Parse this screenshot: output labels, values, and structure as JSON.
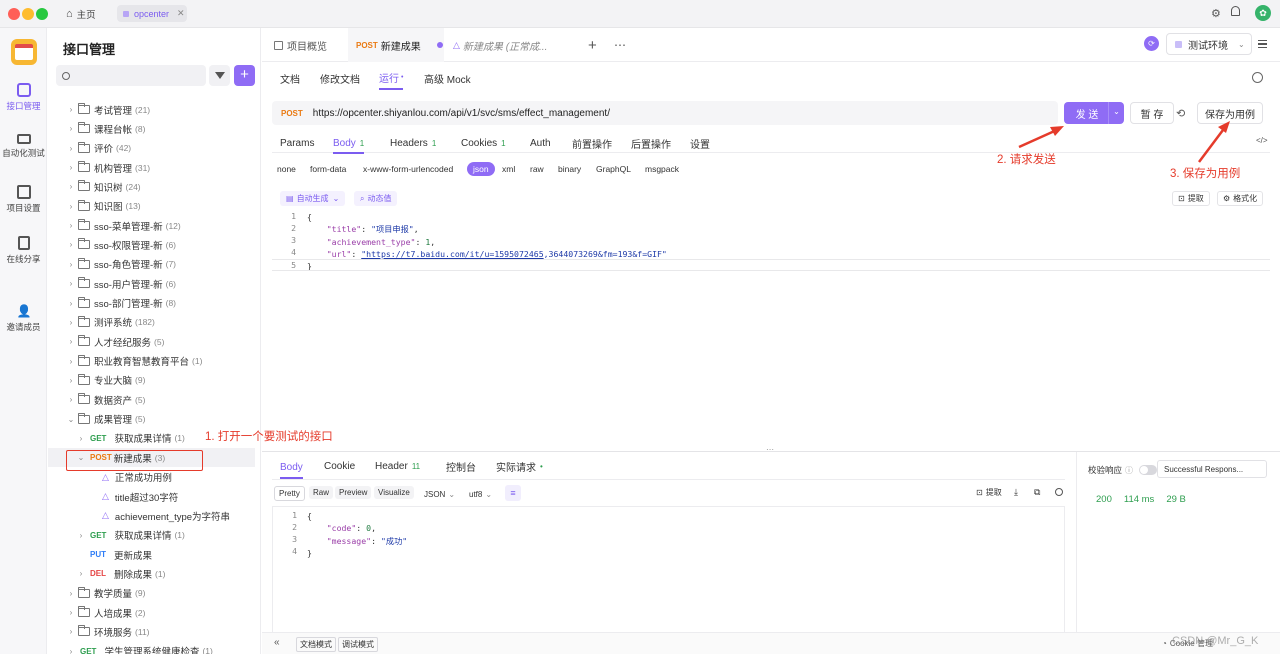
{
  "titlebar": {
    "home": "主页",
    "tab": "opcenter"
  },
  "sidebar": {
    "items": [
      "接口管理",
      "自动化测试",
      "项目设置",
      "在线分享",
      "邀请成员"
    ]
  },
  "tree": {
    "title": "接口管理",
    "folders": [
      {
        "name": "考试管理",
        "count": "(21)"
      },
      {
        "name": "课程台帐",
        "count": "(8)"
      },
      {
        "name": "评价",
        "count": "(42)"
      },
      {
        "name": "机构管理",
        "count": "(31)"
      },
      {
        "name": "知识树",
        "count": "(24)"
      },
      {
        "name": "知识图",
        "count": "(13)"
      },
      {
        "name": "sso-菜单管理-新",
        "count": "(12)"
      },
      {
        "name": "sso-权限管理-新",
        "count": "(6)"
      },
      {
        "name": "sso-角色管理-新",
        "count": "(7)"
      },
      {
        "name": "sso-用户管理-新",
        "count": "(6)"
      },
      {
        "name": "sso-部门管理-新",
        "count": "(8)"
      },
      {
        "name": "测评系统",
        "count": "(182)"
      },
      {
        "name": "人才经纪服务",
        "count": "(5)"
      },
      {
        "name": "职业教育智慧教育平台",
        "count": "(1)"
      },
      {
        "name": "专业大脑",
        "count": "(9)"
      },
      {
        "name": "数据资产",
        "count": "(5)"
      },
      {
        "name": "成果管理",
        "count": "(5)"
      }
    ],
    "achievement_items": [
      {
        "method": "GET",
        "name": "获取成果详情",
        "count": "(1)"
      },
      {
        "method": "POST",
        "name": "新建成果",
        "count": "(3)"
      }
    ],
    "cases": [
      "正常成功用例",
      "title超过30字符",
      "achievement_type为字符串"
    ],
    "after_items": [
      {
        "method": "GET",
        "name": "获取成果详情",
        "count": "(1)"
      },
      {
        "method": "PUT",
        "name": "更新成果",
        "count": ""
      },
      {
        "method": "DEL",
        "name": "删除成果",
        "count": "(1)"
      }
    ],
    "folders_after": [
      {
        "name": "教学质量",
        "count": "(9)"
      },
      {
        "name": "人培成果",
        "count": "(2)"
      },
      {
        "name": "环境服务",
        "count": "(11)"
      }
    ],
    "last_item": {
      "method": "GET",
      "name": "学生管理系统健康检查",
      "count": "(1)"
    }
  },
  "tabs": {
    "overview": "项目概览",
    "active_method": "POST",
    "active": "新建成果",
    "draft": "新建成果 (正常成..."
  },
  "env": "测试环境",
  "subtabs": [
    "文档",
    "修改文档",
    "运行",
    "高级 Mock"
  ],
  "request": {
    "method": "POST",
    "url": "https://opcenter.shiyanlou.com/api/v1/svc/sms/effect_management/",
    "send": "发 送",
    "save_temp": "暂 存",
    "save_case": "保存为用例"
  },
  "param_tabs": [
    {
      "label": "Params",
      "badge": ""
    },
    {
      "label": "Body",
      "badge": "1"
    },
    {
      "label": "Headers",
      "badge": "1"
    },
    {
      "label": "Cookies",
      "badge": "1"
    },
    {
      "label": "Auth",
      "badge": ""
    },
    {
      "label": "前置操作",
      "badge": ""
    },
    {
      "label": "后置操作",
      "badge": ""
    },
    {
      "label": "设置",
      "badge": ""
    }
  ],
  "body_types": [
    "none",
    "form-data",
    "x-www-form-urlencoded",
    "json",
    "xml",
    "raw",
    "binary",
    "GraphQL",
    "msgpack"
  ],
  "tools": {
    "auto": "自动生成",
    "dynamic": "动态值",
    "extract": "提取",
    "format": "格式化"
  },
  "body_code": {
    "title_key": "\"title\"",
    "title_val": "\"项目申报\"",
    "type_key": "\"achievement_type\"",
    "type_val": "1",
    "url_key": "\"url\"",
    "url_val": "\"https://t7.baidu.com/it/u=1595072465",
    "url_tail": ",3644073269&fm=193&f=GIF\""
  },
  "annotations": {
    "a1": "1. 打开一个要测试的接口",
    "a2": "2. 请求发送",
    "a3": "3. 保存为用例"
  },
  "response": {
    "tabs": [
      {
        "label": "Body",
        "badge": ""
      },
      {
        "label": "Cookie",
        "badge": ""
      },
      {
        "label": "Header",
        "badge": "11"
      },
      {
        "label": "控制台",
        "badge": ""
      },
      {
        "label": "实际请求",
        "badge": "•"
      }
    ],
    "views": [
      "Pretty",
      "Raw",
      "Preview",
      "Visualize"
    ],
    "format": "JSON",
    "encoding": "utf8",
    "extract": "提取",
    "code_key": "\"code\"",
    "code_val": "0",
    "msg_key": "\"message\"",
    "msg_val": "\"成功\"",
    "validate_label": "校验响应",
    "validate_value": "Successful Respons...",
    "status": "200",
    "time": "114 ms",
    "size": "29 B"
  },
  "footer": {
    "doc_mode": "文档模式",
    "debug_mode": "调试模式",
    "cookie": "Cookie 管理",
    "watermark": "CSDN @Mr_G_K"
  }
}
